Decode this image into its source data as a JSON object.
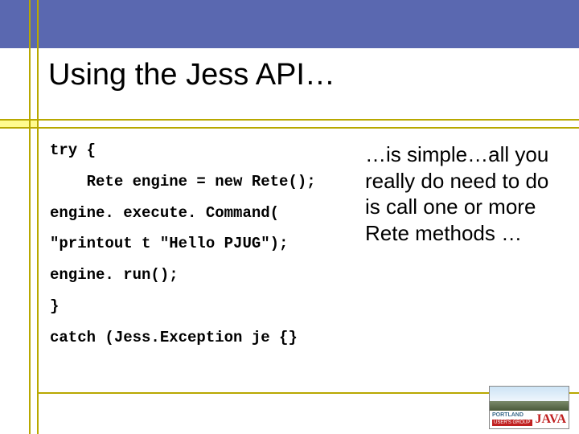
{
  "title": "Using the Jess API…",
  "code": {
    "l1": "try {",
    "l2": "    Rete engine = new Rete();",
    "l3": "engine. execute. Command(",
    "l4": "\"printout t \"Hello PJUG\");",
    "l5": "engine. run();",
    "l6": "}",
    "l7": "catch (Jess.Exception je {}"
  },
  "body": "…is simple…all you really do need to do is call one or more Rete methods …",
  "logo": {
    "portland": "PORTLAND",
    "java": "JAVA",
    "ug": "USER'S GROUP"
  }
}
